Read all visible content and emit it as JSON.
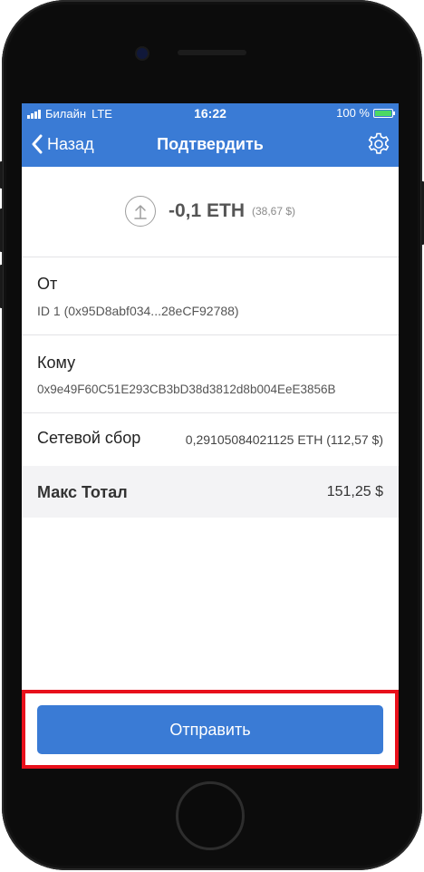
{
  "status_bar": {
    "carrier": "Билайн",
    "network": "LTE",
    "time": "16:22",
    "battery": "100 %"
  },
  "nav": {
    "back_label": "Назад",
    "title": "Подтвердить"
  },
  "amount": {
    "crypto": "-0,1 ETH",
    "fiat": "(38,67 $)"
  },
  "from": {
    "label": "От",
    "value": "ID 1 (0x95D8abf034...28eCF92788)"
  },
  "to": {
    "label": "Кому",
    "value": "0x9e49F60C51E293CB3bD38d3812d8b004EeE3856B"
  },
  "fee": {
    "label": "Сетевой сбор",
    "value": "0,29105084021125 ETH (112,57 $)"
  },
  "total": {
    "label": "Макс Тотал",
    "value": "151,25 $"
  },
  "send_button": {
    "label": "Отправить"
  },
  "colors": {
    "accent": "#3a7bd5",
    "highlight": "#e8101b",
    "battery": "#4cd964"
  },
  "icons": {
    "back": "chevron-left-icon",
    "settings": "gear-icon",
    "send": "arrow-up-circle-icon"
  }
}
